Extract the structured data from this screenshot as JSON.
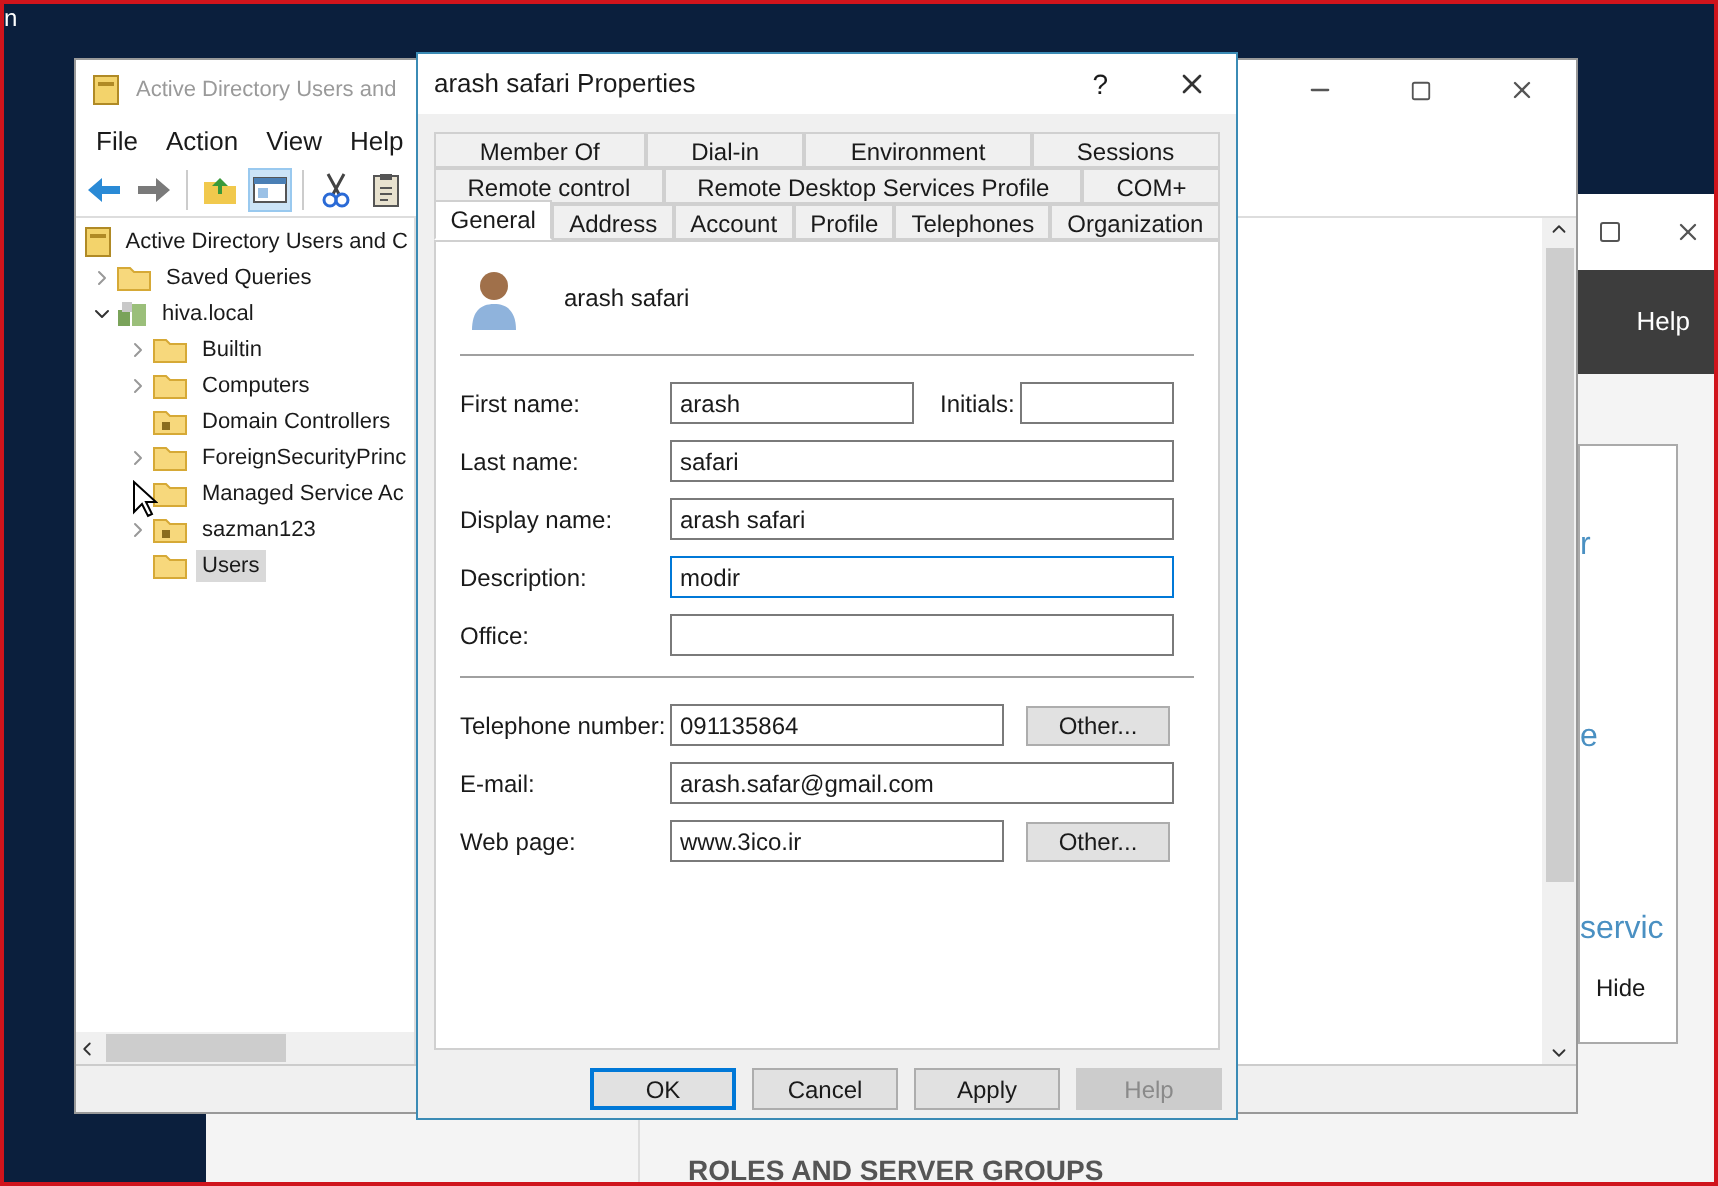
{
  "desktop": {
    "corner_text": "n"
  },
  "server_manager": {
    "header_menu": "Help",
    "partial_texts": [
      "r",
      "e",
      "servic"
    ],
    "link": "Hide",
    "section_title": "ROLES AND SERVER GROUPS"
  },
  "aduc": {
    "title": "Active Directory Users and",
    "menu": [
      "File",
      "Action",
      "View",
      "Help"
    ],
    "toolbar": [
      [
        {
          "kind": "back",
          "pressed": false
        },
        {
          "kind": "forward",
          "pressed": false
        }
      ],
      [
        {
          "kind": "up_folder",
          "pressed": false
        },
        {
          "kind": "console_tree",
          "pressed": true
        }
      ],
      [
        {
          "kind": "cut",
          "pressed": false
        },
        {
          "kind": "paste",
          "pressed": false
        }
      ]
    ],
    "tree": {
      "label": "Active Directory Users and C",
      "kind": "root",
      "selected": false,
      "children": [
        {
          "label": "Saved Queries",
          "kind": "folder",
          "expandable": true,
          "expanded": false,
          "selected": false
        },
        {
          "label": "hiva.local",
          "kind": "domain",
          "expandable": true,
          "expanded": true,
          "selected": false,
          "children": [
            {
              "label": "Builtin",
              "kind": "folder",
              "expandable": true,
              "expanded": false,
              "selected": false
            },
            {
              "label": "Computers",
              "kind": "folder",
              "expandable": true,
              "expanded": false,
              "selected": false
            },
            {
              "label": "Domain Controllers",
              "kind": "ou",
              "expandable": false,
              "expanded": false,
              "selected": false
            },
            {
              "label": "ForeignSecurityPrinc",
              "kind": "folder",
              "expandable": true,
              "expanded": false,
              "selected": false
            },
            {
              "label": "Managed Service Ac",
              "kind": "folder",
              "expandable": false,
              "expanded": false,
              "selected": false
            },
            {
              "label": "sazman123",
              "kind": "ou",
              "expandable": true,
              "expanded": false,
              "selected": false
            },
            {
              "label": "Users",
              "kind": "folder",
              "expandable": false,
              "expanded": false,
              "selected": true
            }
          ]
        }
      ]
    }
  },
  "dialog": {
    "title": "arash safari Properties",
    "help_glyph": "?",
    "tab_rows": [
      [
        {
          "label": "Member Of",
          "selected": false
        },
        {
          "label": "Dial-in",
          "selected": false
        },
        {
          "label": "Environment",
          "selected": false
        },
        {
          "label": "Sessions",
          "selected": false
        }
      ],
      [
        {
          "label": "Remote control",
          "selected": false
        },
        {
          "label": "Remote Desktop Services Profile",
          "selected": false
        },
        {
          "label": "COM+",
          "selected": false
        }
      ],
      [
        {
          "label": "General",
          "selected": true
        },
        {
          "label": "Address",
          "selected": false
        },
        {
          "label": "Account",
          "selected": false
        },
        {
          "label": "Profile",
          "selected": false
        },
        {
          "label": "Telephones",
          "selected": false
        },
        {
          "label": "Organization",
          "selected": false
        }
      ]
    ],
    "user_name": "arash safari",
    "sections": [
      [
        {
          "label": "First name:",
          "value": "arash",
          "focused": false,
          "initials": {
            "label": "Initials:"
          }
        },
        {
          "label": "Last name:",
          "value": "safari",
          "focused": false
        },
        {
          "label": "Display name:",
          "value": "arash safari",
          "focused": false
        },
        {
          "label": "Description:",
          "value": "modir",
          "focused": true
        },
        {
          "label": "Office:",
          "focused": false
        }
      ],
      [
        {
          "label": "Telephone number:",
          "value": "091135864",
          "focused": false,
          "button": "Other..."
        },
        {
          "label": "E-mail:",
          "value": "arash.safar@gmail.com",
          "focused": false
        },
        {
          "label": "Web page:",
          "value": "www.3ico.ir",
          "focused": false,
          "button": "Other..."
        }
      ]
    ],
    "buttons": [
      {
        "label": "OK",
        "default": true,
        "disabled": false
      },
      {
        "label": "Cancel",
        "default": false,
        "disabled": false
      },
      {
        "label": "Apply",
        "default": false,
        "disabled": false
      },
      {
        "label": "Help",
        "default": false,
        "disabled": true
      }
    ]
  }
}
